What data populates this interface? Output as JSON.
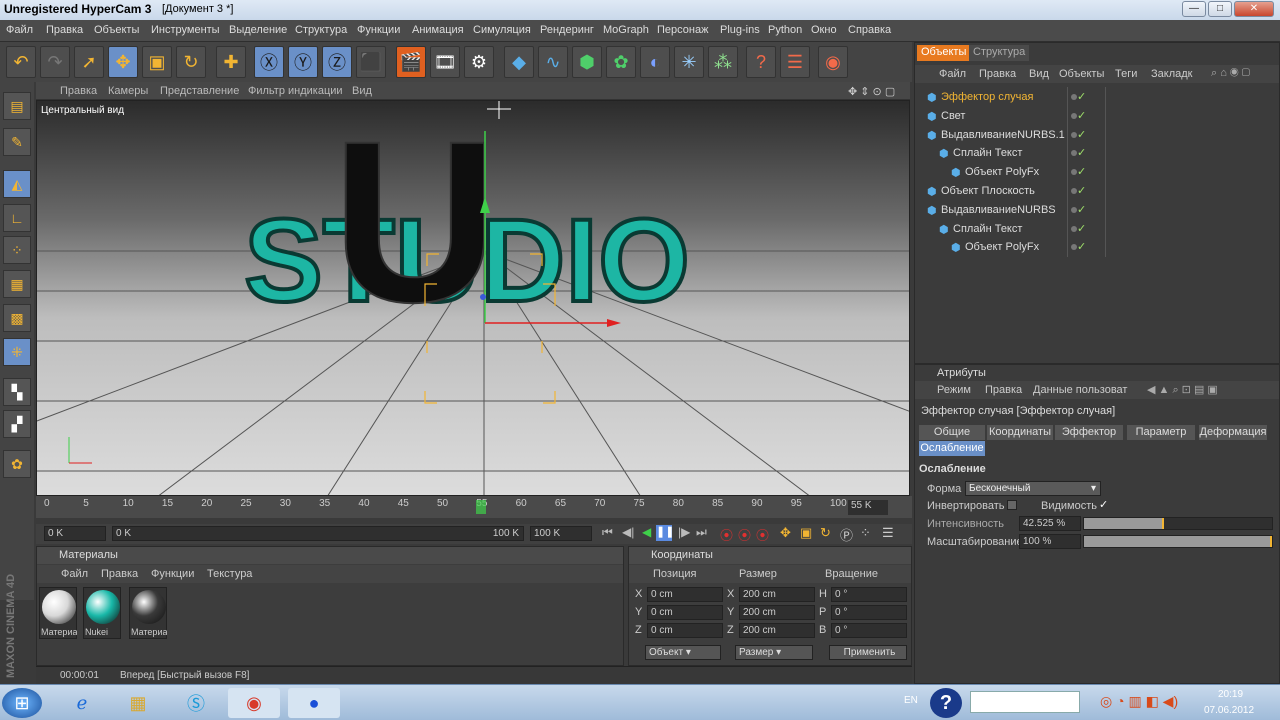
{
  "window": {
    "app_title": "Unregistered HyperCam 3",
    "doc_title": "[Документ 3 *]"
  },
  "menu": [
    "Файл",
    "Правка",
    "Объекты",
    "Инструменты",
    "Выделение",
    "Структура",
    "Функции",
    "Анимация",
    "Симуляция",
    "Рендеринг",
    "MoGraph",
    "Персонаж",
    "Plug-ins",
    "Python",
    "Окно",
    "Справка"
  ],
  "viewport": {
    "menu": [
      "Правка",
      "Камеры",
      "Представление",
      "Фильтр индикации",
      "Вид"
    ],
    "label": "Центральный вид",
    "scene_text": "STUDIO",
    "scene_letter": "U"
  },
  "timeline": {
    "ticks": [
      "0",
      "5",
      "10",
      "15",
      "20",
      "25",
      "30",
      "35",
      "40",
      "45",
      "50",
      "55",
      "60",
      "65",
      "70",
      "75",
      "80",
      "85",
      "90",
      "95",
      "100"
    ],
    "end_label": "55 K",
    "start_field": "0 K",
    "cur_field": "0 K",
    "end_field": "100 K",
    "max_field": "100 K"
  },
  "materials": {
    "title": "Материалы",
    "menu": [
      "Файл",
      "Правка",
      "Функции",
      "Текстура"
    ],
    "items": [
      {
        "label": "Материа",
        "color": "#d8d8d8"
      },
      {
        "label": "Nukei",
        "color": "#18b8a8"
      },
      {
        "label": "Материа",
        "color": "#3a3a3a"
      }
    ]
  },
  "coords": {
    "title": "Координаты",
    "headers": [
      "Позиция",
      "Размер",
      "Вращение"
    ],
    "rows": [
      {
        "axis": "X",
        "pos": "0 cm",
        "saxis": "X",
        "size": "200 cm",
        "raxis": "H",
        "rot": "0 °"
      },
      {
        "axis": "Y",
        "pos": "0 cm",
        "saxis": "Y",
        "size": "200 cm",
        "raxis": "P",
        "rot": "0 °"
      },
      {
        "axis": "Z",
        "pos": "0 cm",
        "saxis": "Z",
        "size": "200 cm",
        "raxis": "B",
        "rot": "0 °"
      }
    ],
    "mode1": "Объект",
    "mode2": "Размер",
    "apply": "Применить"
  },
  "status": {
    "time": "00:00:01",
    "text": "Вперед [Быстрый вызов F8]"
  },
  "logo": "MAXON CINEMA 4D",
  "objects": {
    "tabs": [
      "Объекты",
      "Структура"
    ],
    "menu": [
      "Файл",
      "Правка",
      "Вид",
      "Объекты",
      "Теги",
      "Закладк"
    ],
    "rows": [
      {
        "name": "Эффектор случая",
        "color": "#f2b533",
        "indent": 0
      },
      {
        "name": "Свет",
        "color": "#ddd",
        "indent": 0
      },
      {
        "name": "ВыдавливаниеNURBS.1",
        "color": "#ddd",
        "indent": 0
      },
      {
        "name": "Сплайн Текст",
        "color": "#ddd",
        "indent": 1
      },
      {
        "name": "Объект PolyFx",
        "color": "#ddd",
        "indent": 2
      },
      {
        "name": "Объект Плоскость",
        "color": "#ddd",
        "indent": 0
      },
      {
        "name": "ВыдавливаниеNURBS",
        "color": "#ddd",
        "indent": 0
      },
      {
        "name": "Сплайн Текст",
        "color": "#ddd",
        "indent": 1
      },
      {
        "name": "Объект PolyFx",
        "color": "#ddd",
        "indent": 2
      }
    ]
  },
  "attributes": {
    "title": "Атрибуты",
    "menu": [
      "Режим",
      "Правка",
      "Данные пользоват"
    ],
    "object": "Эффектор случая [Эффектор случая]",
    "tabs": [
      "Общие",
      "Координаты",
      "Эффектор",
      "Параметр",
      "Деформация",
      "Ослабление"
    ],
    "section": "Ослабление",
    "shape_label": "Форма",
    "shape_value": "Бесконечный",
    "invert_label": "Инвертировать",
    "visible_label": "Видимость",
    "intensity_label": "Интенсивность",
    "intensity_value": "42.525 %",
    "intensity": 0.42525,
    "scale_label": "Масштабирование",
    "scale_value": "100 %",
    "scale": 1.0
  },
  "taskbar": {
    "lang": "EN",
    "time": "20:19",
    "date": "07.06.2012"
  }
}
